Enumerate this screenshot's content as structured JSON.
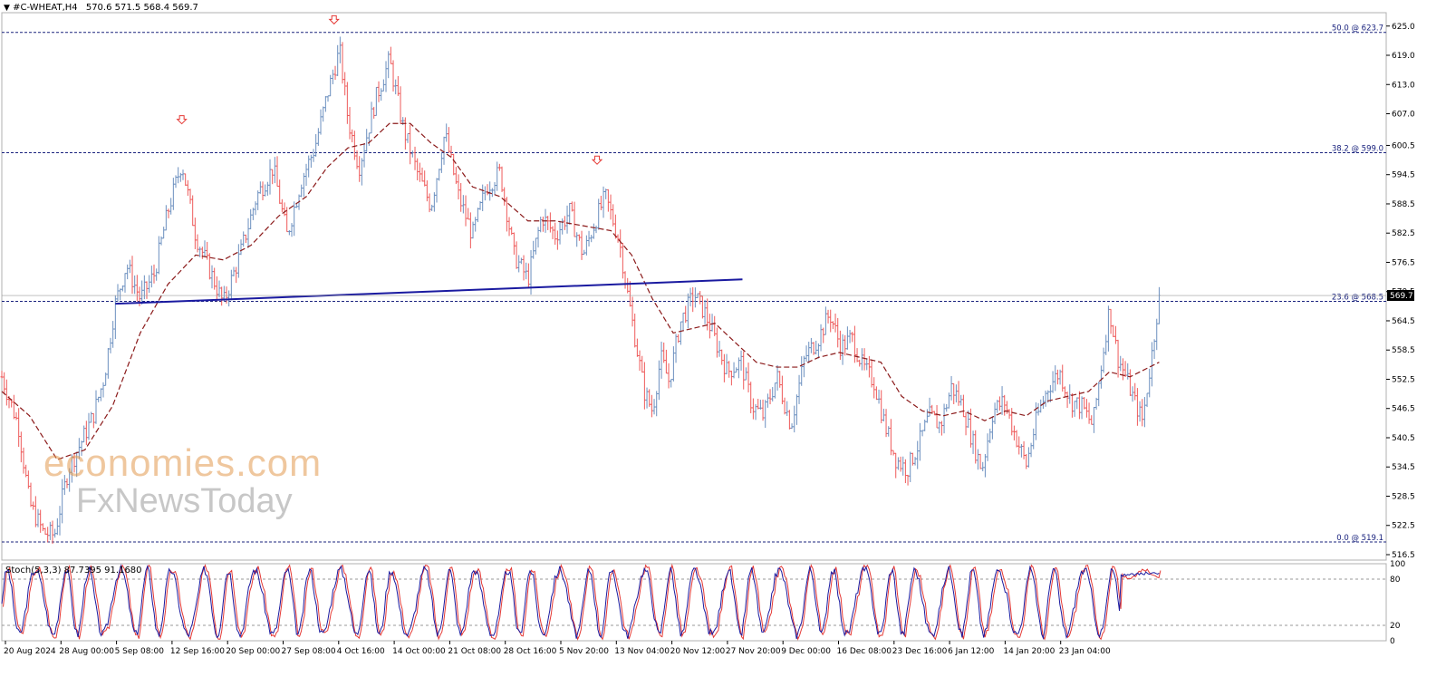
{
  "header": {
    "symbol_label": "#C-WHEAT,H4",
    "ohlc": "570.6 571.5 568.4 569.7"
  },
  "indicator": {
    "label": "Stoch(5,3,3) 87.7395 91.1680",
    "axis_labels": [
      "100",
      "80",
      "20",
      "0"
    ],
    "levels": [
      80,
      20
    ]
  },
  "watermark": {
    "line1": "economies.com",
    "line2": "FxNewsToday"
  },
  "colors": {
    "bull": "#6b8fbf",
    "bear": "#ee5a5a",
    "ma": "#8b1a1a",
    "fib": "#1a237e",
    "trendline": "#1a1aa0",
    "stoch_main": "#1a1aa0",
    "stoch_signal": "#e53935",
    "arrow": "#e53935",
    "last_price_bg": "#000000"
  },
  "chart_data": {
    "type": "candlestick",
    "symbol": "#C-WHEAT",
    "timeframe": "H4",
    "price_axis": {
      "ylim": [
        516.5,
        627
      ],
      "ticks": [
        "625.0",
        "619.0",
        "613.0",
        "607.0",
        "600.5",
        "594.5",
        "588.5",
        "582.5",
        "576.5",
        "570.5",
        "564.5",
        "558.5",
        "552.5",
        "546.5",
        "540.5",
        "534.5",
        "528.5",
        "522.5",
        "516.5"
      ]
    },
    "last_price": "569.7",
    "time_axis": {
      "labels": [
        "20 Aug 2024",
        "28 Aug 00:00",
        "5 Sep 08:00",
        "12 Sep 16:00",
        "20 Sep 00:00",
        "27 Sep 08:00",
        "4 Oct 16:00",
        "14 Oct 00:00",
        "21 Oct 08:00",
        "28 Oct 16:00",
        "5 Nov 20:00",
        "13 Nov 04:00",
        "20 Nov 12:00",
        "27 Nov 20:00",
        "9 Dec 00:00",
        "16 Dec 08:00",
        "23 Dec 16:00",
        "6 Jan 12:00",
        "14 Jan 20:00",
        "23 Jan 04:00"
      ]
    },
    "fib_levels": [
      {
        "label": "50.0 @ 623.7",
        "price": 623.7
      },
      {
        "label": "38.2 @ 599.0",
        "price": 599.0
      },
      {
        "label": "23.6 @ 568.5",
        "price": 568.5
      },
      {
        "label": "0.0 @ 519.1",
        "price": 519.1
      }
    ],
    "trendline": {
      "from": {
        "t": 0.082,
        "price": 568.0
      },
      "to": {
        "t": 0.535,
        "price": 573.0
      }
    },
    "arrow_markers": [
      {
        "t": 0.13,
        "price": 605.5
      },
      {
        "t": 0.24,
        "price": 626.0
      },
      {
        "t": 0.43,
        "price": 597.2
      }
    ],
    "price_path": [
      [
        0.0,
        553
      ],
      [
        0.012,
        543
      ],
      [
        0.02,
        527
      ],
      [
        0.03,
        521
      ],
      [
        0.038,
        520.5
      ],
      [
        0.048,
        534
      ],
      [
        0.058,
        540
      ],
      [
        0.066,
        545
      ],
      [
        0.074,
        553
      ],
      [
        0.082,
        568
      ],
      [
        0.09,
        576
      ],
      [
        0.1,
        569
      ],
      [
        0.11,
        574
      ],
      [
        0.12,
        587
      ],
      [
        0.13,
        597
      ],
      [
        0.14,
        582
      ],
      [
        0.15,
        575
      ],
      [
        0.16,
        568
      ],
      [
        0.172,
        578
      ],
      [
        0.184,
        590
      ],
      [
        0.196,
        596
      ],
      [
        0.206,
        582
      ],
      [
        0.216,
        593
      ],
      [
        0.226,
        600
      ],
      [
        0.236,
        612
      ],
      [
        0.244,
        620
      ],
      [
        0.25,
        606
      ],
      [
        0.258,
        596
      ],
      [
        0.27,
        610
      ],
      [
        0.28,
        618
      ],
      [
        0.29,
        604
      ],
      [
        0.3,
        595
      ],
      [
        0.31,
        588
      ],
      [
        0.32,
        603
      ],
      [
        0.33,
        590
      ],
      [
        0.34,
        582
      ],
      [
        0.35,
        592
      ],
      [
        0.36,
        595
      ],
      [
        0.37,
        578
      ],
      [
        0.38,
        573
      ],
      [
        0.39,
        586
      ],
      [
        0.4,
        582
      ],
      [
        0.41,
        587
      ],
      [
        0.42,
        578
      ],
      [
        0.43,
        586
      ],
      [
        0.436,
        590
      ],
      [
        0.446,
        581
      ],
      [
        0.452,
        570
      ],
      [
        0.458,
        560
      ],
      [
        0.464,
        550
      ],
      [
        0.47,
        546
      ],
      [
        0.476,
        557
      ],
      [
        0.482,
        552
      ],
      [
        0.49,
        564
      ],
      [
        0.5,
        570
      ],
      [
        0.508,
        566
      ],
      [
        0.516,
        560
      ],
      [
        0.524,
        554
      ],
      [
        0.534,
        556
      ],
      [
        0.542,
        547
      ],
      [
        0.55,
        545
      ],
      [
        0.56,
        553
      ],
      [
        0.57,
        543
      ],
      [
        0.58,
        557
      ],
      [
        0.59,
        561
      ],
      [
        0.598,
        566
      ],
      [
        0.606,
        559
      ],
      [
        0.614,
        561
      ],
      [
        0.622,
        555
      ],
      [
        0.63,
        552
      ],
      [
        0.638,
        543
      ],
      [
        0.646,
        536
      ],
      [
        0.654,
        534
      ],
      [
        0.662,
        539
      ],
      [
        0.67,
        545
      ],
      [
        0.678,
        543
      ],
      [
        0.686,
        551
      ],
      [
        0.694,
        547
      ],
      [
        0.702,
        539
      ],
      [
        0.708,
        534
      ],
      [
        0.716,
        546
      ],
      [
        0.724,
        548
      ],
      [
        0.732,
        541
      ],
      [
        0.74,
        535
      ],
      [
        0.748,
        545
      ],
      [
        0.756,
        551
      ],
      [
        0.764,
        554
      ],
      [
        0.772,
        548
      ],
      [
        0.78,
        547
      ],
      [
        0.788,
        543
      ],
      [
        0.796,
        559
      ],
      [
        0.8,
        567
      ],
      [
        0.806,
        557
      ],
      [
        0.812,
        553
      ],
      [
        0.818,
        548
      ],
      [
        0.824,
        544
      ],
      [
        0.83,
        556
      ],
      [
        0.836,
        569.7
      ]
    ],
    "ma_path": [
      [
        0.0,
        550
      ],
      [
        0.02,
        545
      ],
      [
        0.04,
        536
      ],
      [
        0.06,
        538
      ],
      [
        0.08,
        547
      ],
      [
        0.1,
        562
      ],
      [
        0.12,
        572
      ],
      [
        0.14,
        578
      ],
      [
        0.16,
        577
      ],
      [
        0.18,
        580
      ],
      [
        0.2,
        586
      ],
      [
        0.22,
        590
      ],
      [
        0.235,
        596
      ],
      [
        0.25,
        600
      ],
      [
        0.265,
        601
      ],
      [
        0.28,
        605
      ],
      [
        0.295,
        605
      ],
      [
        0.31,
        601
      ],
      [
        0.325,
        598
      ],
      [
        0.34,
        592
      ],
      [
        0.36,
        590
      ],
      [
        0.38,
        585
      ],
      [
        0.4,
        585
      ],
      [
        0.42,
        584
      ],
      [
        0.44,
        583
      ],
      [
        0.455,
        578
      ],
      [
        0.47,
        569
      ],
      [
        0.485,
        562
      ],
      [
        0.5,
        563
      ],
      [
        0.515,
        564
      ],
      [
        0.53,
        560
      ],
      [
        0.545,
        556
      ],
      [
        0.56,
        555
      ],
      [
        0.575,
        555
      ],
      [
        0.59,
        557
      ],
      [
        0.605,
        558
      ],
      [
        0.62,
        557
      ],
      [
        0.635,
        556
      ],
      [
        0.65,
        549
      ],
      [
        0.665,
        546
      ],
      [
        0.68,
        545
      ],
      [
        0.695,
        546
      ],
      [
        0.71,
        544
      ],
      [
        0.725,
        546
      ],
      [
        0.74,
        545
      ],
      [
        0.755,
        548
      ],
      [
        0.77,
        549
      ],
      [
        0.785,
        550
      ],
      [
        0.8,
        554
      ],
      [
        0.815,
        553
      ],
      [
        0.836,
        556
      ]
    ],
    "stoch": {
      "main_last": 87.7395,
      "signal_last": 91.168,
      "cycles": 42
    }
  }
}
